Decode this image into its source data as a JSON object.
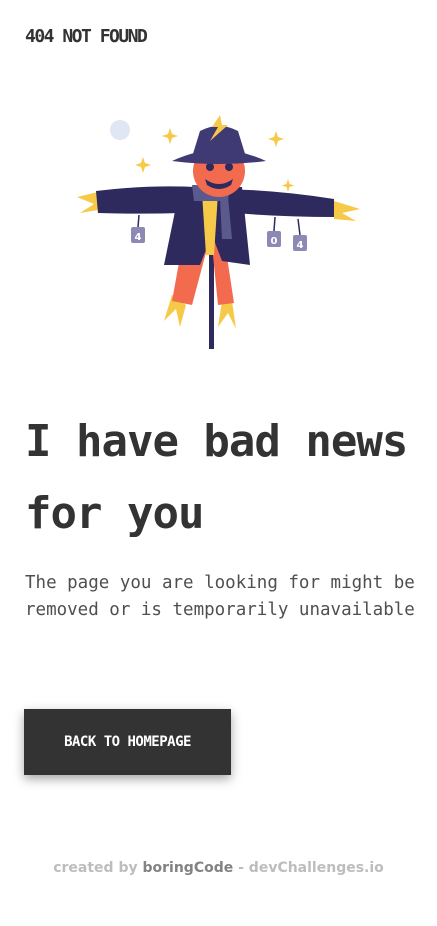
{
  "header": {
    "brand": "404 NOT FOUND"
  },
  "illustration": {
    "name": "scarecrow",
    "tags": [
      "4",
      "0",
      "4"
    ]
  },
  "main": {
    "headline": "I have bad news for you",
    "subtext": "The page you are looking for might be removed or is temporarily unavailable",
    "cta_label": "BACK TO HOMEPAGE"
  },
  "footer": {
    "prefix": "created by",
    "author": "boringCode",
    "separator": "-",
    "site": "devChallenges.io"
  },
  "colors": {
    "text": "#333333",
    "button_bg": "#333333",
    "footer_text": "#BDBDBD",
    "footer_author": "#828282",
    "coat": "#2E2A5E",
    "hat": "#3F3A73",
    "straw": "#F7C948",
    "face": "#F26B4F"
  }
}
